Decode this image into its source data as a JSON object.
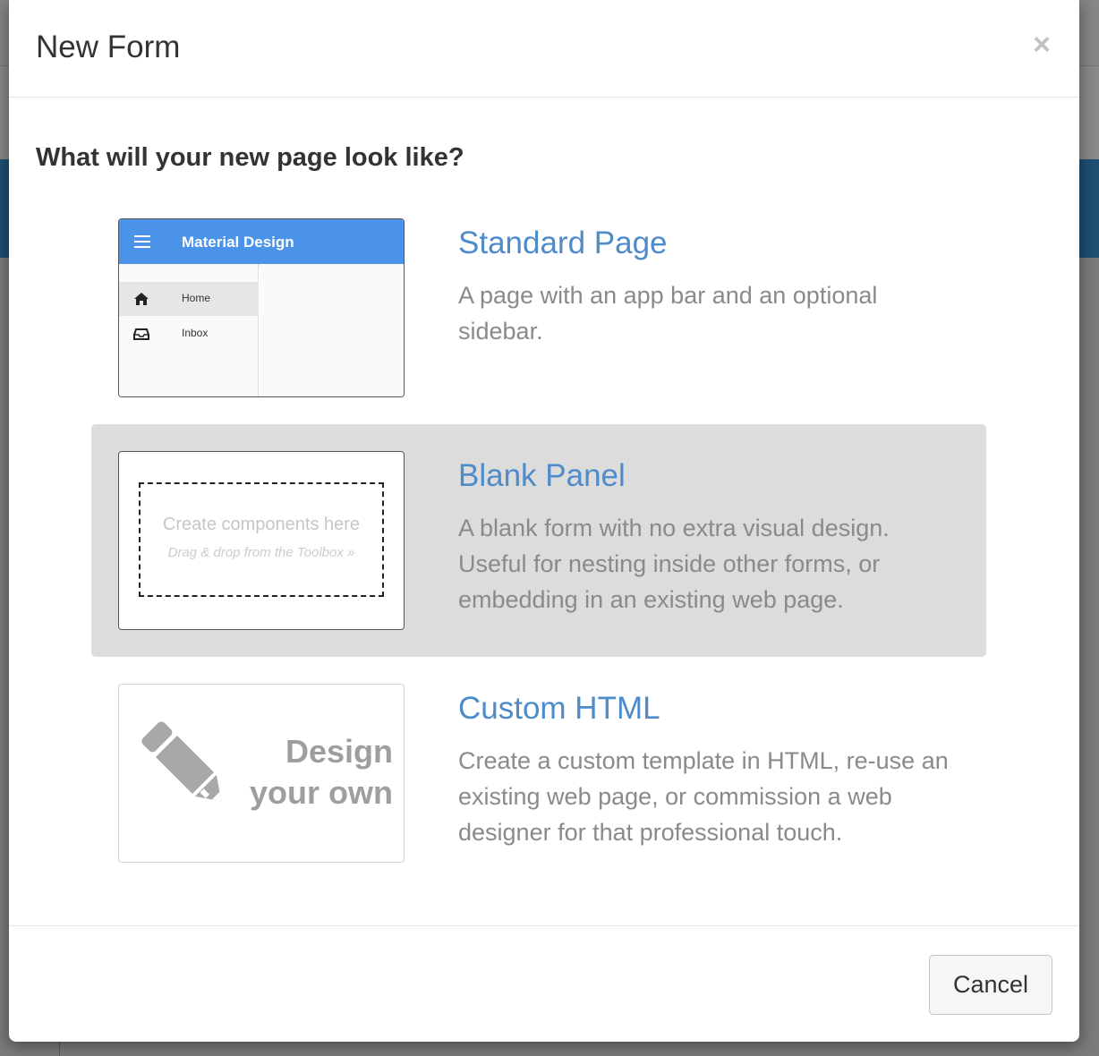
{
  "dialog": {
    "title": "New Form",
    "close_label": "×",
    "question": "What will your new page look like?"
  },
  "options": [
    {
      "title": "Standard Page",
      "description": "A page with an app bar and an optional sidebar.",
      "selected": false,
      "thumbnail": {
        "app_bar_title": "Material Design",
        "items": [
          "Home",
          "Inbox"
        ],
        "accent_color": "#4b93e8"
      }
    },
    {
      "title": "Blank Panel",
      "description": "A blank form with no extra visual design. Useful for nesting inside other forms, or embedding in an existing web page.",
      "selected": true,
      "thumbnail": {
        "line1": "Create components here",
        "line2": "Drag & drop from the Toolbox »"
      }
    },
    {
      "title": "Custom HTML",
      "description": "Create a custom template in HTML, re-use an existing web page, or commission a web designer for that professional touch.",
      "selected": false,
      "thumbnail": {
        "line1": "Design",
        "line2": "your own",
        "icon": "pencil-icon"
      }
    }
  ],
  "footer": {
    "cancel_label": "Cancel"
  },
  "colors": {
    "link_blue": "#4d8bca",
    "selected_bg": "#dcdcdc",
    "desc_gray": "#8a8a8a"
  }
}
